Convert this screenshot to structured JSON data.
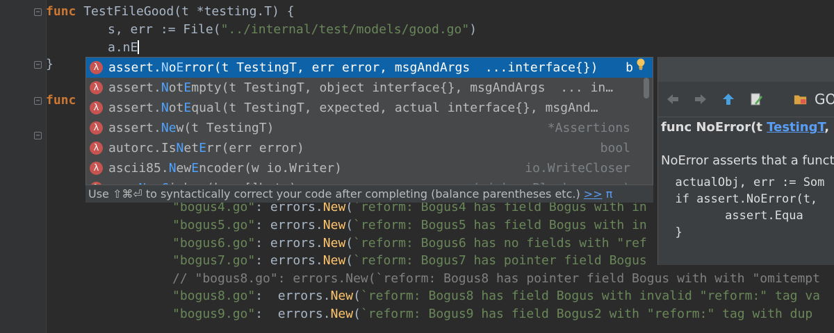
{
  "editor": {
    "lines": [
      {
        "segments": [
          [
            "kw",
            "func "
          ],
          [
            "plain",
            "TestFileGood(t *testing.T) {"
          ]
        ]
      },
      {
        "segments": [
          [
            "plain",
            "s, err := File("
          ],
          [
            "str",
            "\"../internal/test/models/good.go\""
          ],
          [
            "plain",
            ")"
          ]
        ]
      },
      {
        "segments": [
          [
            "plain",
            "a.nE"
          ]
        ]
      },
      {
        "segments": [
          [
            "plain",
            "}"
          ]
        ]
      },
      {
        "segments": [
          [
            "kw",
            "func "
          ]
        ]
      },
      {
        "segments": [
          [
            "str",
            "\"bogus4.go\""
          ],
          [
            "plain",
            ": errors."
          ],
          [
            "fn",
            "New"
          ],
          [
            "plain",
            "("
          ],
          [
            "str",
            "`reform: Bogus4 has field Bogus with in"
          ]
        ]
      },
      {
        "segments": [
          [
            "str",
            "\"bogus5.go\""
          ],
          [
            "plain",
            ": errors."
          ],
          [
            "fn",
            "New"
          ],
          [
            "plain",
            "("
          ],
          [
            "str",
            "`reform: Bogus5 has field Bogus with in"
          ]
        ]
      },
      {
        "segments": [
          [
            "str",
            "\"bogus6.go\""
          ],
          [
            "plain",
            ": errors."
          ],
          [
            "fn",
            "New"
          ],
          [
            "plain",
            "("
          ],
          [
            "str",
            "`reform: Bogus6 has no fields with \"ref"
          ]
        ]
      },
      {
        "segments": [
          [
            "str",
            "\"bogus7.go\""
          ],
          [
            "plain",
            ": errors."
          ],
          [
            "fn",
            "New"
          ],
          [
            "plain",
            "("
          ],
          [
            "str",
            "`reform: Bogus7 has pointer field Bogus"
          ]
        ]
      },
      {
        "segments": [
          [
            "cm",
            "// \"bogus8.go\": errors.New(`reform: Bogus8 has pointer field Bogus with with \"omitempt"
          ]
        ]
      },
      {
        "segments": [
          [
            "str",
            "\"bogus8.go\""
          ],
          [
            "plain",
            ":  errors."
          ],
          [
            "fn",
            "New"
          ],
          [
            "plain",
            "("
          ],
          [
            "str",
            "`reform: Bogus8 has field Bogus with invalid \"reform:\" tag va"
          ]
        ]
      },
      {
        "segments": [
          [
            "str",
            "\"bogus9.go\""
          ],
          [
            "plain",
            ":  errors."
          ],
          [
            "fn",
            "New"
          ],
          [
            "plain",
            "("
          ],
          [
            "str",
            "`reform: Bogus9 has field Bogus2 with \"reform:\" tag with dup"
          ]
        ]
      }
    ]
  },
  "completion": {
    "items": [
      {
        "prefix": "assert.",
        "match": "N",
        "mid": "o",
        "match2": "E",
        "rest": "rror(t TestingT, err error, msgAndArgs  ...interface{})",
        "type": "b",
        "selected": true
      },
      {
        "prefix": "assert.",
        "match": "N",
        "mid": "ot",
        "match2": "E",
        "rest": "mpty(t TestingT, object interface{}, msgAndArgs  ... in…",
        "type": "",
        "selected": false
      },
      {
        "prefix": "assert.",
        "match": "N",
        "mid": "ot",
        "match2": "E",
        "rest": "qual(t TestingT, expected, actual interface{}, msgAnd…",
        "type": "",
        "selected": false
      },
      {
        "prefix": "assert.",
        "match": "N",
        "mid": "",
        "match2": "e",
        "rest": "w(t TestingT)",
        "type": "*Assertions",
        "selected": false
      },
      {
        "prefix": "autorc.Is",
        "match": "N",
        "mid": "et",
        "match2": "E",
        "rest": "rr(err error)",
        "type": "bool",
        "selected": false
      },
      {
        "prefix": "ascii85.",
        "match": "N",
        "mid": "ew",
        "match2": "E",
        "rest": "ncoder(w io.Writer)",
        "type": "io.WriteCloser",
        "selected": false
      },
      {
        "prefix": "aes.",
        "match": "N",
        "mid": "ew",
        "match2": "C",
        "rest": "ipher(key []byte)",
        "type": "(cipher.Block, error)",
        "selected": false
      }
    ],
    "lambda_glyph": "λ",
    "hint_prefix": "Use ⇧⌘⏎ to syntactically correct your code after completing (balance parentheses etc.)",
    "hint_link": ">>",
    "hint_suffix": "π"
  },
  "doc": {
    "gofile_label": "GO",
    "signature_prefix": "func NoError(t ",
    "signature_link": "TestingT",
    "signature_suffix": ", e",
    "description": "NoError asserts that a funct",
    "code": [
      "  actualObj, err := Som",
      "  if assert.NoError(t, ",
      "         assert.Equa",
      "  }"
    ]
  },
  "colors": {
    "selection": "#0d62a8",
    "keyword": "#cc7832",
    "string": "#6a8759",
    "function": "#ffc66d"
  },
  "icons": [
    "back-arrow-icon",
    "forward-arrow-icon",
    "up-arrow-icon",
    "edit-source-icon",
    "folder-icon",
    "lightbulb-icon",
    "lambda-icon"
  ]
}
